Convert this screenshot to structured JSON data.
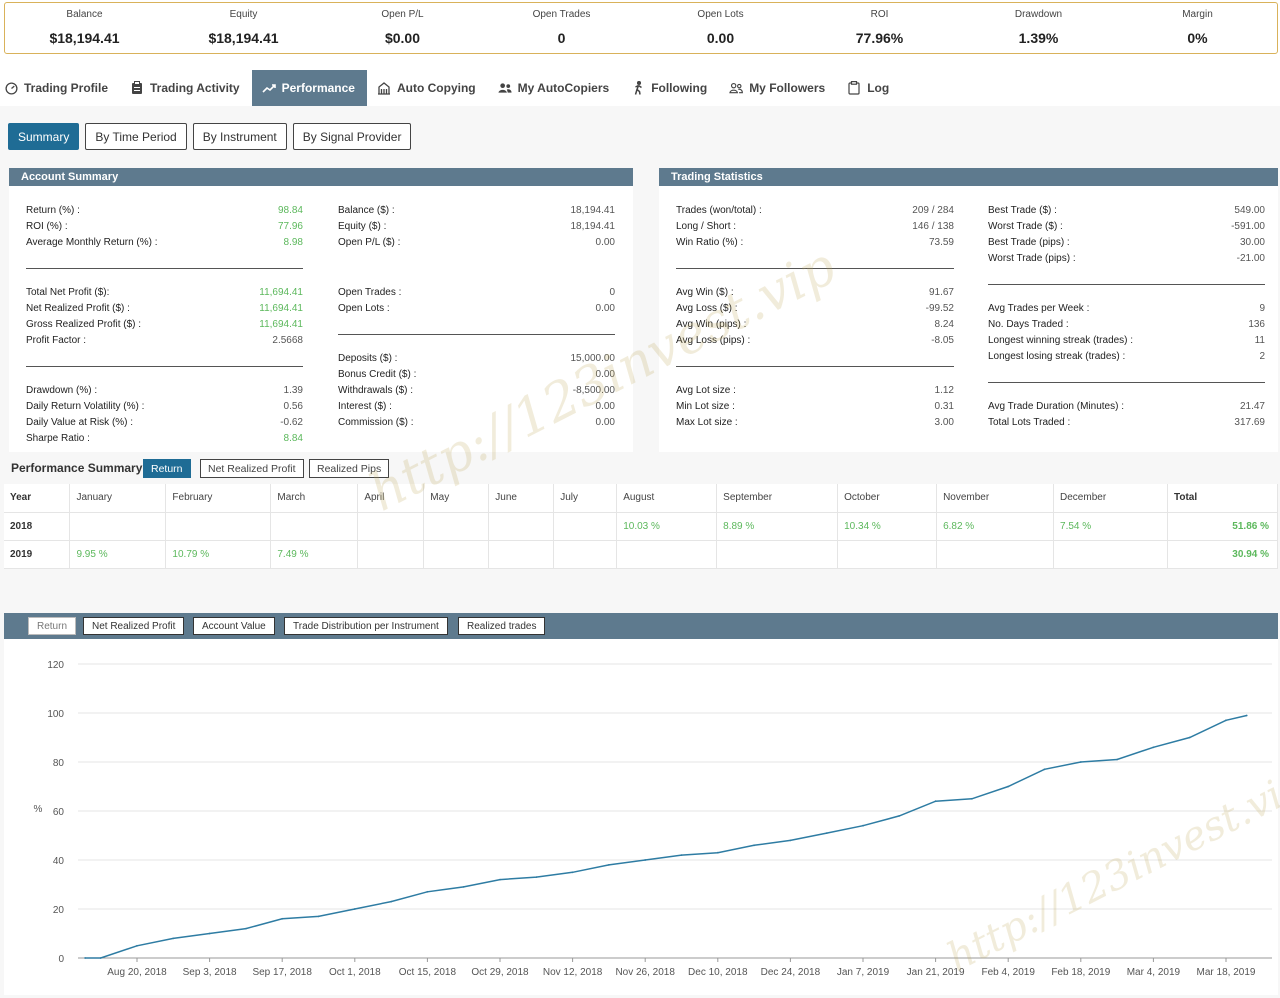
{
  "stats": [
    {
      "label": "Balance",
      "value": "$18,194.41"
    },
    {
      "label": "Equity",
      "value": "$18,194.41"
    },
    {
      "label": "Open P/L",
      "value": "$0.00"
    },
    {
      "label": "Open Trades",
      "value": "0"
    },
    {
      "label": "Open Lots",
      "value": "0.00"
    },
    {
      "label": "ROI",
      "value": "77.96%"
    },
    {
      "label": "Drawdown",
      "value": "1.39%"
    },
    {
      "label": "Margin",
      "value": "0%"
    }
  ],
  "tabs": [
    {
      "label": "Trading Profile",
      "icon": "dashboard-icon"
    },
    {
      "label": "Trading Activity",
      "icon": "clipboard-icon"
    },
    {
      "label": "Performance",
      "icon": "trend-line-icon"
    },
    {
      "label": "Auto Copying",
      "icon": "building-icon"
    },
    {
      "label": "My AutoCopiers",
      "icon": "users-icon"
    },
    {
      "label": "Following",
      "icon": "walking-icon"
    },
    {
      "label": "My Followers",
      "icon": "users-outline-icon"
    },
    {
      "label": "Log",
      "icon": "clipboard-list-icon"
    }
  ],
  "subtabs": [
    "Summary",
    "By Time Period",
    "By Instrument",
    "By Signal Provider"
  ],
  "account_summary": {
    "title": "Account Summary",
    "col1": [
      {
        "k": "Return (%) :",
        "v": "98.84",
        "green": true
      },
      {
        "k": "ROI (%) :",
        "v": "77.96",
        "green": true
      },
      {
        "k": "Average Monthly Return (%) :",
        "v": "8.98",
        "green": true
      },
      {
        "k": "Total Net Profit ($):",
        "v": "11,694.41",
        "green": true
      },
      {
        "k": "Net Realized Profit ($) :",
        "v": "11,694.41",
        "green": true
      },
      {
        "k": "Gross Realized Profit ($) :",
        "v": "11,694.41",
        "green": true
      },
      {
        "k": "Profit Factor :",
        "v": "2.5668",
        "green": false
      },
      {
        "k": "Drawdown (%) :",
        "v": "1.39",
        "green": false
      },
      {
        "k": "Daily Return Volatility (%) :",
        "v": "0.56",
        "green": false
      },
      {
        "k": "Daily Value at Risk (%) :",
        "v": "-0.62",
        "green": false
      },
      {
        "k": "Sharpe Ratio :",
        "v": "8.84",
        "green": true
      }
    ],
    "col2": [
      {
        "k": "Balance ($) :",
        "v": "18,194.41"
      },
      {
        "k": "Equity ($) :",
        "v": "18,194.41"
      },
      {
        "k": "Open P/L ($) :",
        "v": "0.00"
      },
      {
        "k": "Open Trades :",
        "v": "0"
      },
      {
        "k": "Open Lots :",
        "v": "0.00"
      },
      {
        "k": "Deposits ($) :",
        "v": "15,000.00"
      },
      {
        "k": "Bonus Credit ($) :",
        "v": "0.00"
      },
      {
        "k": "Withdrawals ($) :",
        "v": "-8,500.00"
      },
      {
        "k": "Interest ($) :",
        "v": "0.00"
      },
      {
        "k": "Commission ($) :",
        "v": "0.00"
      }
    ]
  },
  "trading_statistics": {
    "title": "Trading Statistics",
    "col1": [
      {
        "k": "Trades (won/total) :",
        "v": "209 / 284"
      },
      {
        "k": "Long / Short :",
        "v": "146 / 138"
      },
      {
        "k": "Win Ratio (%) :",
        "v": "73.59"
      },
      {
        "k": "Avg Win ($) :",
        "v": "91.67"
      },
      {
        "k": "Avg Loss ($) :",
        "v": "-99.52"
      },
      {
        "k": "Avg Win (pips) :",
        "v": "8.24"
      },
      {
        "k": "Avg Loss (pips) :",
        "v": "-8.05"
      },
      {
        "k": "Avg Lot size :",
        "v": "1.12"
      },
      {
        "k": "Min Lot size :",
        "v": "0.31"
      },
      {
        "k": "Max Lot size :",
        "v": "3.00"
      }
    ],
    "col2": [
      {
        "k": "Best Trade ($) :",
        "v": "549.00"
      },
      {
        "k": "Worst Trade ($) :",
        "v": "-591.00"
      },
      {
        "k": "Best Trade (pips) :",
        "v": "30.00"
      },
      {
        "k": "Worst Trade (pips) :",
        "v": "-21.00"
      },
      {
        "k": "Avg Trades per Week :",
        "v": "9"
      },
      {
        "k": "No. Days Traded :",
        "v": "136"
      },
      {
        "k": "Longest winning streak (trades) :",
        "v": "11"
      },
      {
        "k": "Longest losing streak (trades) :",
        "v": "2"
      },
      {
        "k": "Avg Trade Duration (Minutes) :",
        "v": "21.47"
      },
      {
        "k": "Total Lots Traded :",
        "v": "317.69"
      }
    ]
  },
  "performance_summary": {
    "title": "Performance Summary",
    "buttons": [
      "Return",
      "Net Realized Profit",
      "Realized Pips"
    ],
    "headers": [
      "Year",
      "January",
      "February",
      "March",
      "April",
      "May",
      "June",
      "July",
      "August",
      "September",
      "October",
      "November",
      "December",
      "Total"
    ],
    "rows": [
      [
        "2018",
        "",
        "",
        "",
        "",
        "",
        "",
        "",
        "10.03 %",
        "8.89 %",
        "10.34 %",
        "6.82 %",
        "7.54 %",
        "51.86 %"
      ],
      [
        "2019",
        "9.95 %",
        "10.79 %",
        "7.49 %",
        "",
        "",
        "",
        "",
        "",
        "",
        "",
        "",
        "",
        "30.94 %"
      ]
    ]
  },
  "chart_buttons": [
    "Return",
    "Net Realized Profit",
    "Account Value",
    "Trade Distribution per Instrument",
    "Realized trades"
  ],
  "watermark": "http://123invest.vip",
  "chart_data": {
    "type": "line",
    "ylabel": "%",
    "ylim": [
      0,
      120
    ],
    "yticks": [
      0,
      20,
      40,
      60,
      80,
      100,
      120
    ],
    "xticks": [
      "Aug 20, 2018",
      "Sep 3, 2018",
      "Sep 17, 2018",
      "Oct 1, 2018",
      "Oct 15, 2018",
      "Oct 29, 2018",
      "Nov 12, 2018",
      "Nov 26, 2018",
      "Dec 10, 2018",
      "Dec 24, 2018",
      "Jan 7, 2019",
      "Jan 21, 2019",
      "Feb 4, 2019",
      "Feb 18, 2019",
      "Mar 4, 2019",
      "Mar 18, 2019"
    ],
    "x": [
      "Aug 10, 2018",
      "Aug 13, 2018",
      "Aug 20, 2018",
      "Aug 27, 2018",
      "Sep 3, 2018",
      "Sep 10, 2018",
      "Sep 17, 2018",
      "Sep 24, 2018",
      "Oct 1, 2018",
      "Oct 8, 2018",
      "Oct 15, 2018",
      "Oct 22, 2018",
      "Oct 29, 2018",
      "Nov 5, 2018",
      "Nov 12, 2018",
      "Nov 19, 2018",
      "Nov 26, 2018",
      "Dec 3, 2018",
      "Dec 10, 2018",
      "Dec 17, 2018",
      "Dec 24, 2018",
      "Dec 31, 2018",
      "Jan 7, 2019",
      "Jan 14, 2019",
      "Jan 21, 2019",
      "Jan 28, 2019",
      "Feb 4, 2019",
      "Feb 11, 2019",
      "Feb 18, 2019",
      "Feb 25, 2019",
      "Mar 4, 2019",
      "Mar 11, 2019",
      "Mar 18, 2019",
      "Mar 22, 2019"
    ],
    "values": [
      0,
      0,
      5,
      8,
      10,
      12,
      16,
      17,
      20,
      23,
      27,
      29,
      32,
      33,
      35,
      38,
      40,
      42,
      43,
      46,
      48,
      51,
      54,
      58,
      64,
      65,
      70,
      77,
      80,
      81,
      86,
      90,
      97,
      99
    ],
    "color": "#2e7ca3",
    "grid": true,
    "legend": "none"
  }
}
